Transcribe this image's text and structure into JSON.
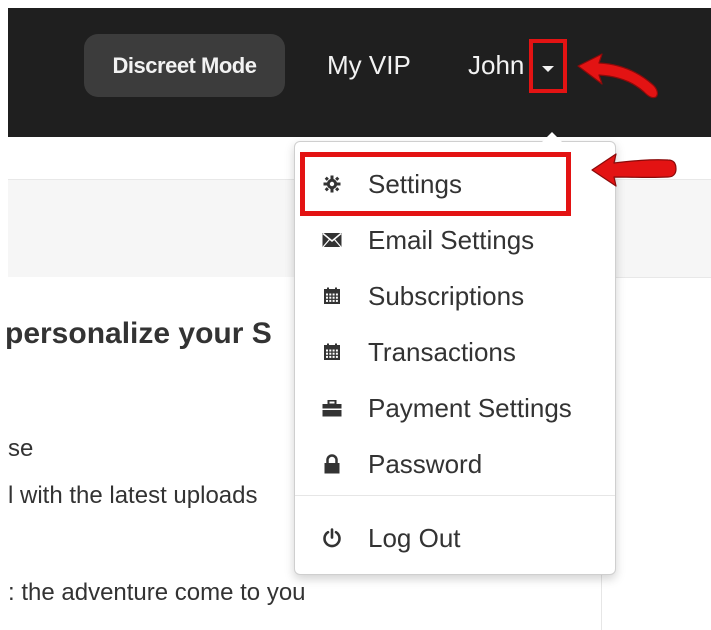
{
  "header": {
    "discreet_mode_label": "Discreet Mode",
    "my_vip_label": "My VIP",
    "user_name": "John"
  },
  "page": {
    "heading": "personalize your S",
    "lines": [
      "se",
      "l with the latest uploads",
      ": the adventure come to you",
      ""
    ]
  },
  "dropdown": {
    "items": [
      {
        "label": "Settings",
        "icon": "gear-icon"
      },
      {
        "label": "Email Settings",
        "icon": "envelope-icon"
      },
      {
        "label": "Subscriptions",
        "icon": "calendar-icon"
      },
      {
        "label": "Transactions",
        "icon": "calendar-icon"
      },
      {
        "label": "Payment Settings",
        "icon": "briefcase-icon"
      },
      {
        "label": "Password",
        "icon": "lock-icon"
      }
    ],
    "logout_label": "Log Out",
    "logout_icon": "power-icon"
  },
  "colors": {
    "topbar": "#1f1f1f",
    "highlight": "#e31313",
    "text": "#333333"
  }
}
